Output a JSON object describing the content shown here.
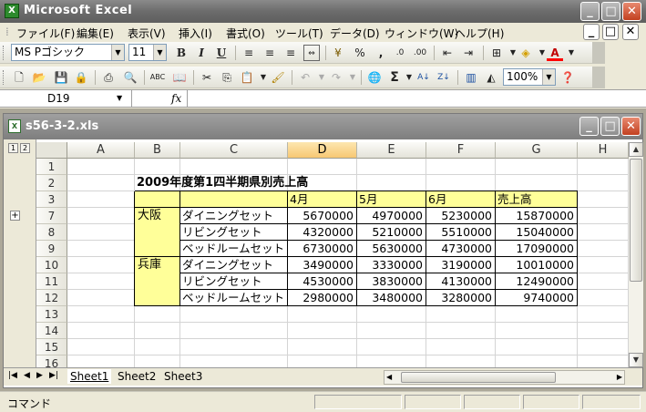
{
  "app": {
    "title": "Microsoft Excel",
    "icon": "X"
  },
  "menu": [
    "ファイル(F)",
    "編集(E)",
    "表示(V)",
    "挿入(I)",
    "書式(O)",
    "ツール(T)",
    "データ(D)",
    "ウィンドウ(W)",
    "ヘルプ(H)"
  ],
  "format_toolbar": {
    "font": "MS Pゴシック",
    "size": "11",
    "bold": "B",
    "italic": "I",
    "underline": "U",
    "percent": "%",
    "comma": ","
  },
  "standard_toolbar": {
    "zoom": "100%",
    "sigma": "Σ"
  },
  "formula_bar": {
    "name_box": "D19",
    "fx": "fx",
    "content": ""
  },
  "workbook": {
    "title": "s56-3-2.xls"
  },
  "outline": {
    "levels": [
      "1",
      "2"
    ],
    "expand": "+"
  },
  "columns": [
    "A",
    "B",
    "C",
    "D",
    "E",
    "F",
    "G",
    "H"
  ],
  "selected_column": "D",
  "rows": [
    "1",
    "2",
    "3",
    "7",
    "8",
    "9",
    "10",
    "11",
    "12",
    "13",
    "14",
    "15",
    "16"
  ],
  "sheet": {
    "title": "2009年度第1四半期県別売上高",
    "headers": [
      "4月",
      "5月",
      "6月",
      "売上高"
    ],
    "regions": [
      "大阪",
      "兵庫"
    ],
    "data": [
      {
        "item": "ダイニングセット",
        "m4": "5670000",
        "m5": "4970000",
        "m6": "5230000",
        "total": "15870000"
      },
      {
        "item": "リビングセット",
        "m4": "4320000",
        "m5": "5210000",
        "m6": "5510000",
        "total": "15040000"
      },
      {
        "item": "ベッドルームセット",
        "m4": "6730000",
        "m5": "5630000",
        "m6": "4730000",
        "total": "17090000"
      },
      {
        "item": "ダイニングセット",
        "m4": "3490000",
        "m5": "3330000",
        "m6": "3190000",
        "total": "10010000"
      },
      {
        "item": "リビングセット",
        "m4": "4530000",
        "m5": "3830000",
        "m6": "4130000",
        "total": "12490000"
      },
      {
        "item": "ベッドルームセット",
        "m4": "2980000",
        "m5": "3480000",
        "m6": "3280000",
        "total": "9740000"
      }
    ]
  },
  "tabs": [
    "Sheet1",
    "Sheet2",
    "Sheet3"
  ],
  "status": "コマンド",
  "colors": {
    "header_fill": "#ffff99",
    "selected_header": "#f7c873"
  }
}
